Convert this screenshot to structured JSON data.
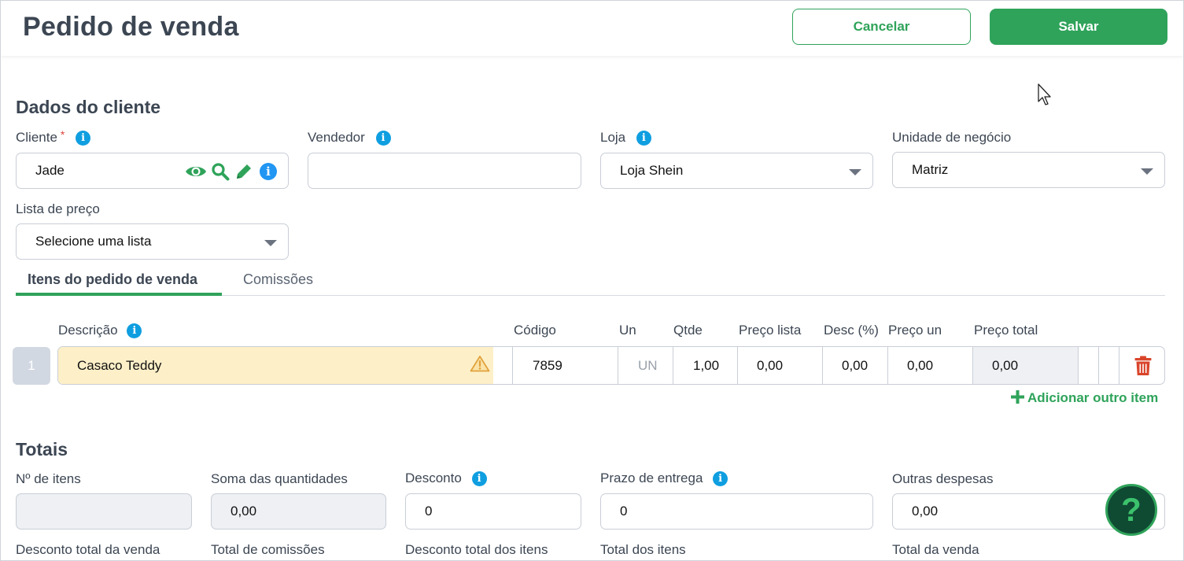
{
  "header": {
    "title": "Pedido de venda",
    "cancel_label": "Cancelar",
    "save_label": "Salvar"
  },
  "client_section": {
    "title": "Dados do cliente",
    "cliente": {
      "label": "Cliente",
      "required_mark": "*",
      "value": "Jade"
    },
    "vendedor": {
      "label": "Vendedor",
      "value": ""
    },
    "loja": {
      "label": "Loja",
      "value": "Loja Shein"
    },
    "unidade": {
      "label": "Unidade de negócio",
      "value": "Matriz"
    },
    "lista_preco": {
      "label": "Lista de preço",
      "value": "Selecione uma lista"
    }
  },
  "tabs": [
    {
      "label": "Itens do pedido de venda",
      "active": true
    },
    {
      "label": "Comissões",
      "active": false
    }
  ],
  "items_table": {
    "headers": {
      "descricao": "Descrição",
      "codigo": "Código",
      "un": "Un",
      "qtde": "Qtde",
      "preco_lista": "Preço lista",
      "desc": "Desc (%)",
      "preco_un": "Preço un",
      "preco_total": "Preço total"
    },
    "rows": [
      {
        "num": "1",
        "descricao": "Casaco Teddy",
        "codigo": "7859",
        "un": "UN",
        "qtde": "1,00",
        "preco_lista": "0,00",
        "desc": "0,00",
        "preco_un": "0,00",
        "preco_total": "0,00"
      }
    ],
    "add_label": "Adicionar outro item"
  },
  "totals": {
    "title": "Totais",
    "n_itens": {
      "label": "Nº de itens",
      "value": ""
    },
    "soma_quantidades": {
      "label": "Soma das quantidades",
      "value": "0,00"
    },
    "desconto": {
      "label": "Desconto",
      "value": "0"
    },
    "prazo_entrega": {
      "label": "Prazo de entrega",
      "value": "0"
    },
    "outras_despesas": {
      "label": "Outras despesas",
      "value": "0,00"
    },
    "bottom_labels": [
      "Desconto total da venda",
      "Total de comissões",
      "Desconto total dos itens",
      "Total dos itens",
      "Total da venda"
    ]
  },
  "help": {
    "label": "?"
  },
  "colors": {
    "accent": "#2fa35a",
    "info": "#0f9ee0",
    "danger": "#d9452b",
    "warning_bg": "#fdf0c8"
  }
}
